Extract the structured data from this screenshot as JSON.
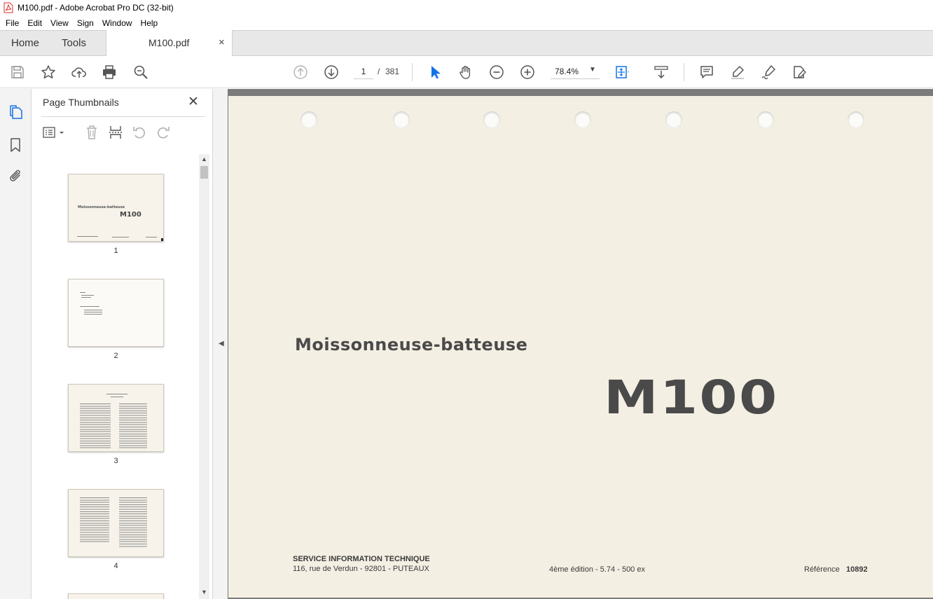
{
  "window": {
    "title": "M100.pdf - Adobe Acrobat Pro DC (32-bit)"
  },
  "menu": [
    "File",
    "Edit",
    "View",
    "Sign",
    "Window",
    "Help"
  ],
  "tabs": {
    "home": "Home",
    "tools": "Tools",
    "document": "M100.pdf",
    "close": "×"
  },
  "toolbar": {
    "current_page": "1",
    "page_separator": "/",
    "total_pages": "381",
    "zoom": "78.4%",
    "zoom_caret": "▼"
  },
  "panel": {
    "title": "Page Thumbnails",
    "close": "✕",
    "thumbnails": [
      {
        "label": "1"
      },
      {
        "label": "2"
      },
      {
        "label": "3"
      },
      {
        "label": "4"
      }
    ]
  },
  "thumbnail_text": {
    "page1_heading": "Moissonneuse-batteuse",
    "page1_model": "M100"
  },
  "document": {
    "heading": "Moissonneuse-batteuse",
    "model": "M100",
    "service": "SERVICE INFORMATION TECHNIQUE",
    "address": "116, rue de Verdun - 92801 - PUTEAUX",
    "edition": "4ème édition - 5.74 - 500 ex",
    "reference_label": "Référence",
    "reference_value": "10892"
  },
  "icons": {
    "app": "acrobat-pdf-icon",
    "save": "save-icon",
    "bookmark_star": "star-icon",
    "upload": "cloud-upload-icon",
    "print": "printer-icon",
    "search": "search-icon",
    "prev_page": "arrow-up-circle-icon",
    "next_page": "arrow-down-circle-icon",
    "select": "cursor-icon",
    "hand": "hand-icon",
    "zoom_out": "zoom-out-icon",
    "zoom_in": "zoom-in-icon",
    "fit": "fit-page-icon",
    "scroll_mode": "scroll-mode-icon",
    "comment": "comment-icon",
    "highlight": "highlighter-icon",
    "sign": "sign-icon",
    "edit": "edit-pdf-icon"
  },
  "colors": {
    "accent": "#1473e6",
    "page_paper": "#f4efe3",
    "doc_background": "#7b7b7b"
  }
}
